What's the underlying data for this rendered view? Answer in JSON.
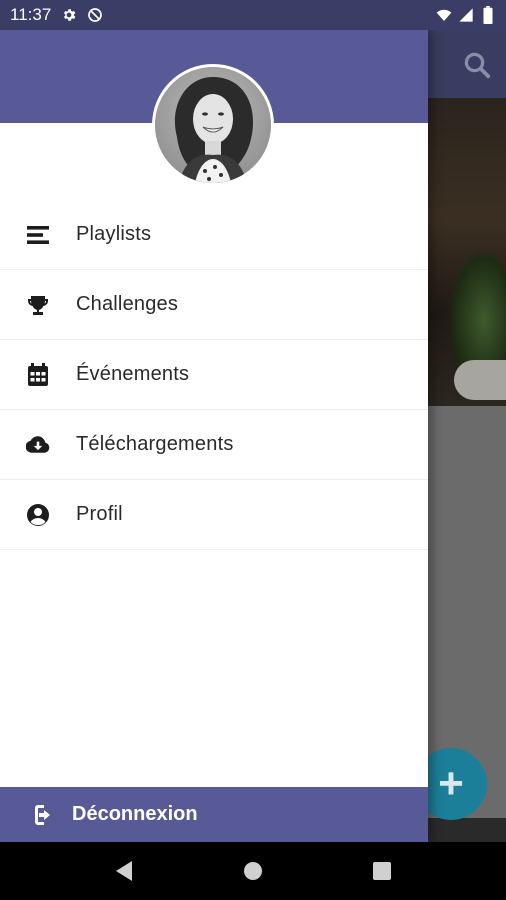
{
  "status_bar": {
    "time": "11:37",
    "left_icons": [
      "settings-icon",
      "do-not-disturb-icon"
    ],
    "right_icons": [
      "wifi-icon",
      "signal-icon",
      "battery-icon"
    ]
  },
  "background_app": {
    "toolbar_icon": "search-icon",
    "fab_icon": "plus-icon",
    "fab_color": "#1c7f99"
  },
  "drawer": {
    "header_color": "#575a96",
    "avatar": "profile-photo",
    "menu_items": [
      {
        "label": "Playlists",
        "icon": "playlist-icon"
      },
      {
        "label": "Challenges",
        "icon": "trophy-icon"
      },
      {
        "label": "Événements",
        "icon": "calendar-icon"
      },
      {
        "label": "Téléchargements",
        "icon": "cloud-download-icon"
      },
      {
        "label": "Profil",
        "icon": "account-circle-icon"
      }
    ],
    "logout": {
      "label": "Déconnexion",
      "icon": "logout-icon"
    }
  },
  "nav_bar": {
    "buttons": [
      "back-icon",
      "home-icon",
      "recents-icon"
    ]
  }
}
